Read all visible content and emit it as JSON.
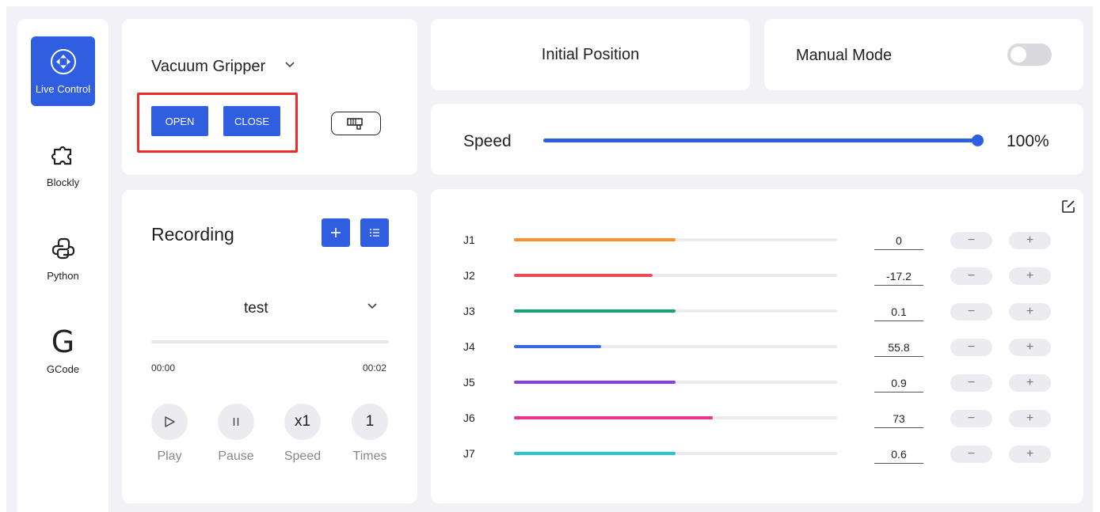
{
  "sidebar": {
    "items": [
      {
        "label": "Live Control",
        "icon": "move-icon",
        "active": true
      },
      {
        "label": "Blockly",
        "icon": "puzzle-icon"
      },
      {
        "label": "Python",
        "icon": "python-icon"
      },
      {
        "label": "GCode",
        "icon": "g-letter-icon",
        "glyph": "G"
      }
    ]
  },
  "gripper": {
    "selected": "Vacuum Gripper",
    "open_label": "OPEN",
    "close_label": "CLOSE",
    "icon": "vacuum-gripper-icon"
  },
  "recording": {
    "title": "Recording",
    "selected_file": "test",
    "time_start": "00:00",
    "time_end": "00:02",
    "controls": [
      {
        "glyph": "▷",
        "label": "Play",
        "icon": "play-icon"
      },
      {
        "glyph": "II",
        "label": "Pause",
        "icon": "pause-icon"
      },
      {
        "glyph": "x1",
        "label": "Speed"
      },
      {
        "glyph": "1",
        "label": "Times"
      }
    ]
  },
  "initial_position": {
    "label": "Initial Position"
  },
  "manual_mode": {
    "label": "Manual Mode",
    "enabled": false
  },
  "speed": {
    "label": "Speed",
    "value": 100,
    "display": "100%"
  },
  "joints": [
    {
      "name": "J1",
      "value": "0",
      "fill": 0.5,
      "color": "#f98f2a"
    },
    {
      "name": "J2",
      "value": "-17.2",
      "fill": 0.43,
      "color": "#ed4c57"
    },
    {
      "name": "J3",
      "value": "0.1",
      "fill": 0.5,
      "color": "#12a577"
    },
    {
      "name": "J4",
      "value": "55.8",
      "fill": 0.27,
      "color": "#3c67e0"
    },
    {
      "name": "J5",
      "value": "0.9",
      "fill": 0.5,
      "color": "#8a3de6"
    },
    {
      "name": "J6",
      "value": "73",
      "fill": 0.615,
      "color": "#e6338f"
    },
    {
      "name": "J7",
      "value": "0.6",
      "fill": 0.5,
      "color": "#27c2d6"
    }
  ],
  "joint_buttons": {
    "minus": "−",
    "plus": "+"
  },
  "colors": {
    "accent": "#2f5fe0",
    "highlight": "#ee2b2b"
  }
}
